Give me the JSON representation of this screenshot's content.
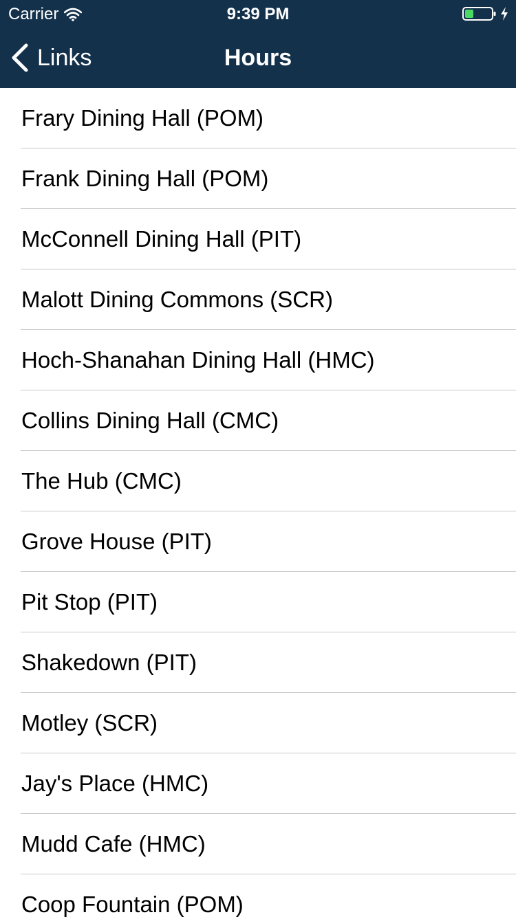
{
  "status_bar": {
    "carrier": "Carrier",
    "time": "9:39 PM",
    "wifi_icon": "wifi-icon",
    "battery_icon": "battery-charging-icon",
    "battery_color": "#4cd964"
  },
  "nav_bar": {
    "back_label": "Links",
    "title": "Hours",
    "background_color": "#14314b"
  },
  "list": {
    "items": [
      {
        "label": "Frary Dining Hall (POM)"
      },
      {
        "label": "Frank Dining Hall (POM)"
      },
      {
        "label": "McConnell Dining Hall (PIT)"
      },
      {
        "label": "Malott Dining Commons (SCR)"
      },
      {
        "label": "Hoch-Shanahan Dining Hall (HMC)"
      },
      {
        "label": "Collins Dining Hall (CMC)"
      },
      {
        "label": "The Hub (CMC)"
      },
      {
        "label": "Grove House (PIT)"
      },
      {
        "label": "Pit Stop (PIT)"
      },
      {
        "label": "Shakedown (PIT)"
      },
      {
        "label": "Motley (SCR)"
      },
      {
        "label": "Jay's Place (HMC)"
      },
      {
        "label": "Mudd Cafe (HMC)"
      },
      {
        "label": "Coop Fountain (POM)"
      }
    ]
  }
}
